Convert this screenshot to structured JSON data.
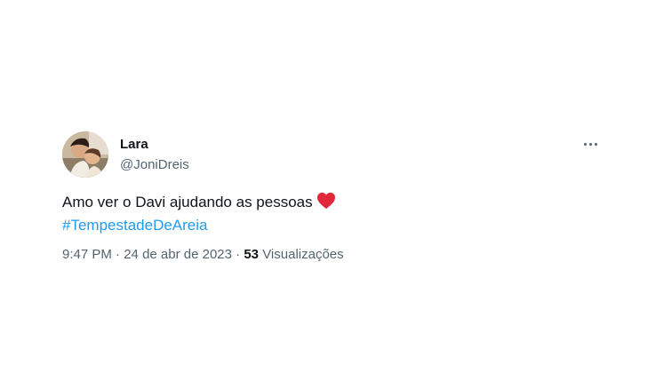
{
  "tweet": {
    "display_name": "Lara",
    "handle": "@JoniDreis",
    "text": "Amo ver o Davi ajudando as pessoas",
    "heart_icon": "red-heart-emoji",
    "hashtag": "#TempestadeDeAreia",
    "time": "9:47 PM",
    "separator": "·",
    "date": "24 de abr de 2023",
    "views_count": "53",
    "views_label": "Visualizações",
    "more_icon": "more-dots-icon"
  },
  "colors": {
    "text_primary": "#0f1419",
    "text_secondary": "#536471",
    "link": "#1d9bf0",
    "heart": "#e0283a"
  }
}
